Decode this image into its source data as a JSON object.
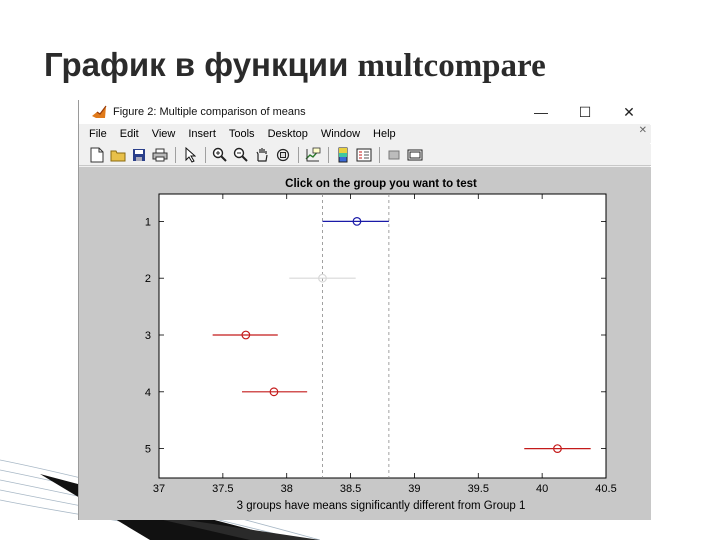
{
  "slide": {
    "title_prefix": "График в функции ",
    "title_code": "multcompare"
  },
  "window": {
    "title": "Figure 2: Multiple comparison of means",
    "controls": {
      "minimize": "—",
      "maximize": "☐",
      "close": "✕"
    }
  },
  "menu": [
    "File",
    "Edit",
    "View",
    "Insert",
    "Tools",
    "Desktop",
    "Window",
    "Help"
  ],
  "toolbar_icons": [
    "new-figure-icon",
    "open-file-icon",
    "save-icon",
    "print-icon",
    "pointer-icon",
    "zoom-in-icon",
    "zoom-out-icon",
    "pan-icon",
    "rotate-3d-icon",
    "data-cursor-icon",
    "colorbar-icon",
    "legend-icon",
    "hide-plot-tools-icon",
    "show-plot-tools-icon"
  ],
  "chart_data": {
    "type": "scatter",
    "title": "Click on the group you want to test",
    "xlabel": "3 groups have means significantly different from Group 1",
    "ylabel": "",
    "xlim": [
      37,
      40.5
    ],
    "x_ticks": [
      "37",
      "37.5",
      "38",
      "38.5",
      "39",
      "39.5",
      "40",
      "40.5"
    ],
    "y_ticks": [
      "1",
      "2",
      "3",
      "4",
      "5"
    ],
    "reference_lines": [
      38.28,
      38.8
    ],
    "colors": {
      "selected": "#1a1aa8",
      "neutral": "#d8d8d8",
      "different": "#c41a1a"
    },
    "groups": [
      {
        "label": "1",
        "mean": 38.55,
        "lower": 38.28,
        "upper": 38.8,
        "status": "selected"
      },
      {
        "label": "2",
        "mean": 38.28,
        "lower": 38.02,
        "upper": 38.54,
        "status": "neutral"
      },
      {
        "label": "3",
        "mean": 37.68,
        "lower": 37.42,
        "upper": 37.93,
        "status": "different"
      },
      {
        "label": "4",
        "mean": 37.9,
        "lower": 37.65,
        "upper": 38.16,
        "status": "different"
      },
      {
        "label": "5",
        "mean": 40.12,
        "lower": 39.86,
        "upper": 40.38,
        "status": "different"
      }
    ]
  }
}
